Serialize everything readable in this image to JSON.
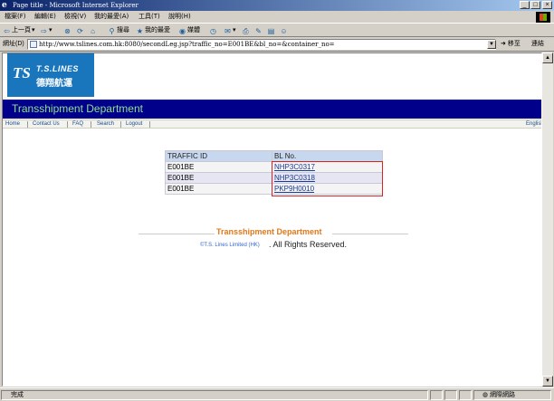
{
  "window": {
    "title": "Page title - Microsoft Internet Explorer",
    "buttons": {
      "minimize": "_",
      "maximize": "□",
      "close": "×"
    }
  },
  "menu": [
    "檔案(F)",
    "編輯(E)",
    "檢視(V)",
    "我的最愛(A)",
    "工具(T)",
    "說明(H)"
  ],
  "toolbar": {
    "back": "上一頁",
    "search": "搜尋",
    "favorites": "我的最愛",
    "media": "媒體"
  },
  "address": {
    "label": "網址(D)",
    "url": "http://www.tslines.com.hk:8080/secondLeg.jsp?traffic_no=E001BE&bl_no=&container_no=",
    "go": "移至",
    "links": "連結"
  },
  "site": {
    "logo_name": "T.S.LINES",
    "logo_cn": "德翔航運",
    "logo_mark": "TS",
    "department": "Transshipment Department",
    "nav": [
      "Home",
      "Contact Us",
      "FAQ",
      "Search",
      "Logout"
    ],
    "language": "English"
  },
  "table": {
    "headers": [
      "TRAFFIC ID",
      "BL No."
    ],
    "rows": [
      {
        "traffic_id": "E001BE",
        "bl_no": "NHP3C0317"
      },
      {
        "traffic_id": "E001BE",
        "bl_no": "NHP3C0318"
      },
      {
        "traffic_id": "E001BE",
        "bl_no": "PKP9H0010"
      }
    ]
  },
  "footer": {
    "title": "Transshipment Department",
    "company": "©T.S. Lines Limited (HK)",
    "rights": ". All Rights Reserved."
  },
  "status": {
    "text": "完成",
    "zone": "網際網路"
  },
  "colors": {
    "title_bar": "#0a246a",
    "logo_bg": "#1976bd",
    "dept_bar": "#00008b",
    "dept_title": "#8fe08f",
    "footer_title": "#e0781a",
    "highlight_frame": "#dd2222"
  }
}
